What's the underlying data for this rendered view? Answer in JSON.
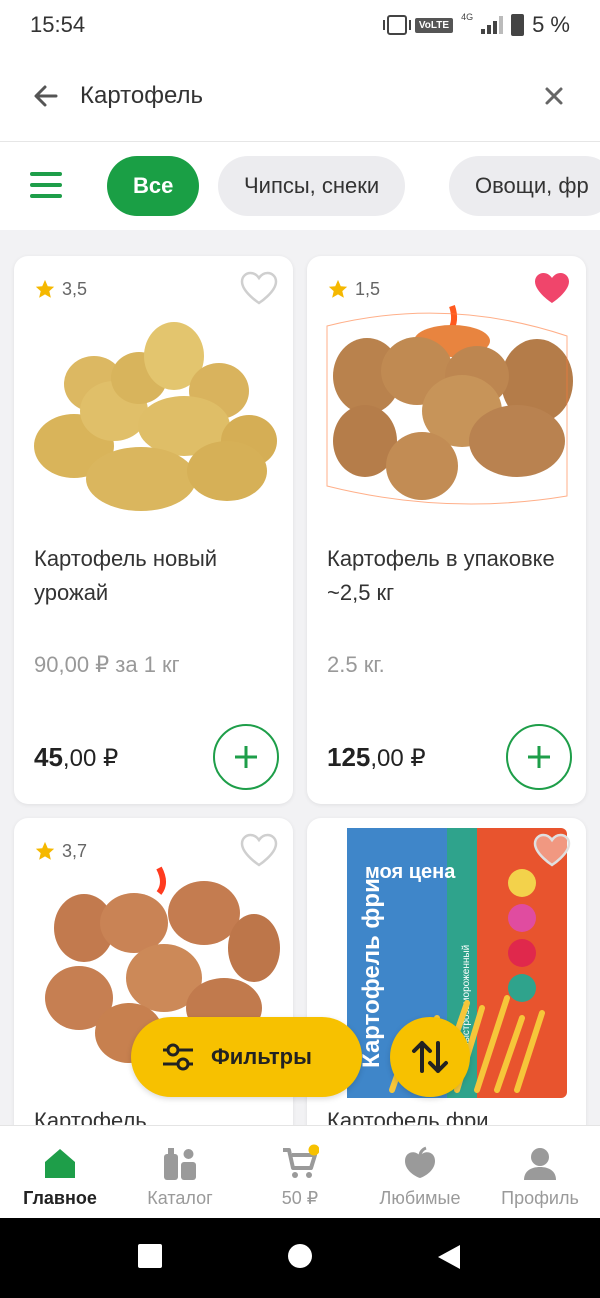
{
  "status_bar": {
    "time": "15:54",
    "battery": "5 %",
    "network_tag": "VoLTE",
    "signal_tag": "4G"
  },
  "search": {
    "query": "Картофель"
  },
  "filter_chips": [
    {
      "label": "Все",
      "active": true
    },
    {
      "label": "Чипсы, снеки",
      "active": false
    },
    {
      "label": "Овощи, фр",
      "active": false
    }
  ],
  "products": [
    {
      "rating": "3,5",
      "favorite": false,
      "title": "Картофель новый урожай",
      "unit_price": "90,00 ₽ за 1 кг",
      "price_main": "45",
      "price_cents": ",00 ₽"
    },
    {
      "rating": "1,5",
      "favorite": true,
      "title": "Картофель в упаковке ~2,5 кг",
      "unit_price": "2.5 кг.",
      "price_main": "125",
      "price_cents": ",00 ₽"
    },
    {
      "rating": "3,7",
      "favorite": false,
      "title": "Картофель",
      "unit_price": "",
      "price_main": "",
      "price_cents": ""
    },
    {
      "rating": "",
      "favorite": false,
      "title": "Картофель фри",
      "unit_price": "",
      "price_main": "",
      "price_cents": "",
      "package_brand": "моя цена",
      "package_name": "Картофель фри",
      "package_note": "быстрозамороженный"
    }
  ],
  "fab": {
    "filters_label": "Фильтры"
  },
  "bottom_nav": [
    {
      "label": "Главное",
      "icon": "home-icon",
      "active": true
    },
    {
      "label": "Каталог",
      "icon": "catalog-icon",
      "active": false
    },
    {
      "label": "50 ₽",
      "icon": "cart-icon",
      "active": false
    },
    {
      "label": "Любимые",
      "icon": "favorites-icon",
      "active": false
    },
    {
      "label": "Профиль",
      "icon": "profile-icon",
      "active": false
    }
  ],
  "colors": {
    "brand_green": "#1e9e49",
    "accent_yellow": "#f7c100",
    "favorite_pink": "#f0456b"
  }
}
